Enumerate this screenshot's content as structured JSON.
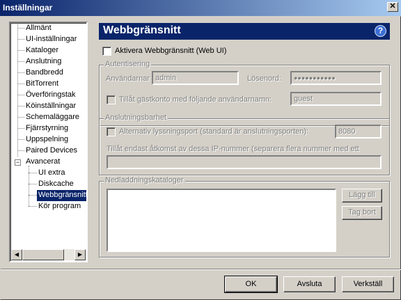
{
  "window": {
    "title": "Inställningar"
  },
  "tree": {
    "items": [
      {
        "label": "Allmänt"
      },
      {
        "label": "UI-inställningar"
      },
      {
        "label": "Kataloger"
      },
      {
        "label": "Anslutning"
      },
      {
        "label": "Bandbredd"
      },
      {
        "label": "BitTorrent"
      },
      {
        "label": "Överföringstak"
      },
      {
        "label": "Köinställningar"
      },
      {
        "label": "Schemaläggare"
      },
      {
        "label": "Fjärrstyrning"
      },
      {
        "label": "Uppspelning"
      },
      {
        "label": "Paired Devices"
      },
      {
        "label": "Avancerat",
        "expander": "−"
      },
      {
        "label": "UI extra"
      },
      {
        "label": "Diskcache"
      },
      {
        "label": "Webbgränsnitt",
        "selected": true
      },
      {
        "label": "Kör program"
      }
    ]
  },
  "header": {
    "title": "Webbgränsnitt",
    "help": "?"
  },
  "enable_webui": {
    "label": "Aktivera Webbgränsnitt (Web UI)"
  },
  "auth": {
    "legend": "Autentisering",
    "username_label": "Användarnar",
    "username_value": "admin",
    "password_label": "Lösenord:",
    "password_value": "●●●●●●●●●●●",
    "guest_label": "Tillåt gästkonto med följande användarnamn:",
    "guest_value": "guest"
  },
  "connectivity": {
    "legend": "Anslutningsbarhet",
    "alt_port_label": "Alternativ lyssningsport (standard är anslutningsporten):",
    "alt_port_value": "8080",
    "ip_label": "Tillåt endast åtkomst av dessa IP-nummer (separera flera nummer med ett",
    "ip_value": ""
  },
  "downloads": {
    "legend": "Nedladdningskataloger",
    "add_label": "Lägg till",
    "remove_label": "Tag bort"
  },
  "footer": {
    "ok_label": "OK",
    "cancel_label": "Avsluta",
    "apply_label": "Verkställ"
  }
}
